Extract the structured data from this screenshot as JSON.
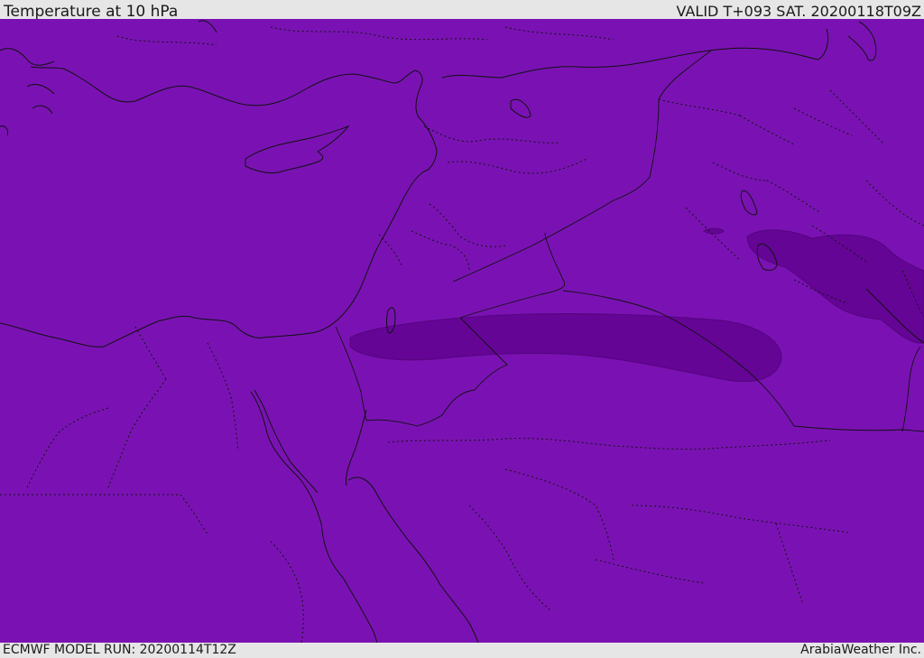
{
  "header": {
    "title": "Temperature at 10 hPa",
    "valid": "VALID T+093 SAT. 20200118T09Z"
  },
  "footer": {
    "model_run": "ECMWF MODEL RUN: 20200114T12Z",
    "credit": "ArabiaWeather Inc."
  },
  "map": {
    "fill_color": "#7a12b3",
    "band_color": "#640596"
  }
}
